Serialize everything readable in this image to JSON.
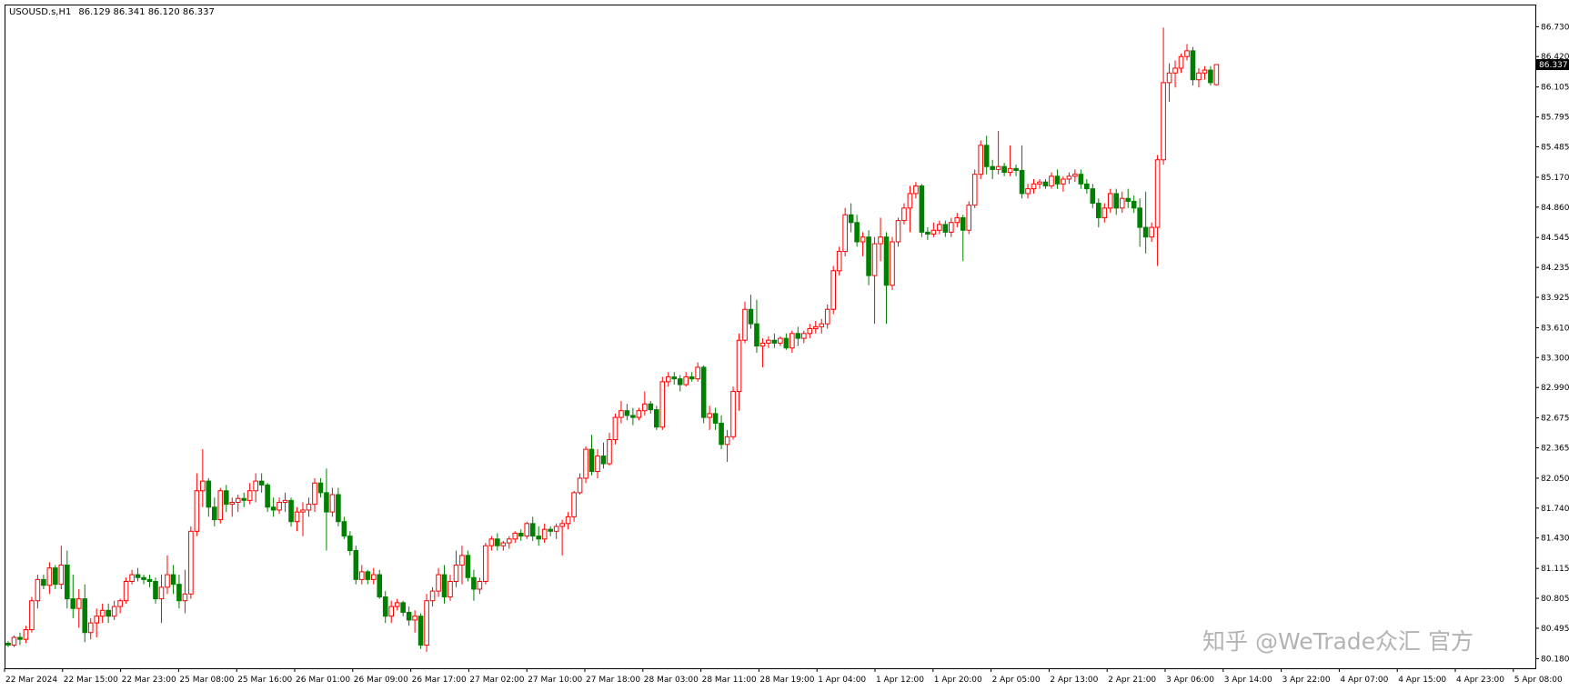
{
  "header": {
    "symbol": "USOUSD.s,H1",
    "ohlc": "86.129 86.341 86.120 86.337"
  },
  "watermark": "知乎 @WeTrade众汇 官方",
  "colors": {
    "bull_body": "#ffffff",
    "bull_outline": "#ff0000",
    "bear_body": "#008000",
    "bear_outline": "#008000",
    "axis": "#000000",
    "price_tag_bg": "#000000",
    "price_tag_text": "#ffffff"
  },
  "chart_data": {
    "type": "candlestick",
    "timeframe": "H1",
    "current_price": "86.337",
    "ylim": [
      80.08,
      86.95
    ],
    "y_ticks": [
      "86.730",
      "86.420",
      "86.105",
      "85.795",
      "85.485",
      "85.170",
      "84.860",
      "84.545",
      "84.235",
      "83.925",
      "83.610",
      "83.300",
      "82.990",
      "82.675",
      "82.365",
      "82.050",
      "81.740",
      "81.430",
      "81.115",
      "80.805",
      "80.495",
      "80.180"
    ],
    "x_ticks": [
      "22 Mar 2024",
      "22 Mar 15:00",
      "22 Mar 23:00",
      "25 Mar 08:00",
      "25 Mar 16:00",
      "26 Mar 01:00",
      "26 Mar 09:00",
      "26 Mar 17:00",
      "27 Mar 02:00",
      "27 Mar 10:00",
      "27 Mar 18:00",
      "28 Mar 03:00",
      "28 Mar 11:00",
      "28 Mar 19:00",
      "1 Apr 04:00",
      "1 Apr 12:00",
      "1 Apr 20:00",
      "2 Apr 05:00",
      "2 Apr 13:00",
      "2 Apr 21:00",
      "3 Apr 06:00",
      "3 Apr 14:00",
      "3 Apr 22:00",
      "4 Apr 07:00",
      "4 Apr 15:00",
      "4 Apr 23:00",
      "5 Apr 08:00"
    ],
    "ohlc": [
      [
        80.34,
        80.36,
        80.3,
        80.32
      ],
      [
        80.32,
        80.42,
        80.3,
        80.4
      ],
      [
        80.4,
        80.45,
        80.32,
        80.38
      ],
      [
        80.38,
        80.52,
        80.34,
        80.48
      ],
      [
        80.48,
        80.82,
        80.45,
        80.78
      ],
      [
        80.78,
        81.05,
        80.7,
        81.0
      ],
      [
        81.0,
        81.05,
        80.9,
        80.94
      ],
      [
        80.94,
        81.18,
        80.85,
        81.12
      ],
      [
        81.12,
        81.15,
        80.9,
        80.95
      ],
      [
        80.95,
        81.35,
        80.9,
        81.15
      ],
      [
        81.15,
        81.3,
        80.7,
        80.8
      ],
      [
        80.8,
        81.05,
        80.6,
        80.7
      ],
      [
        80.7,
        80.9,
        80.5,
        80.8
      ],
      [
        80.8,
        80.95,
        80.35,
        80.45
      ],
      [
        80.45,
        80.6,
        80.38,
        80.55
      ],
      [
        80.55,
        80.7,
        80.4,
        80.62
      ],
      [
        80.62,
        80.75,
        80.55,
        80.68
      ],
      [
        80.68,
        80.75,
        80.55,
        80.62
      ],
      [
        80.62,
        80.78,
        80.58,
        80.72
      ],
      [
        80.72,
        80.8,
        80.65,
        80.78
      ],
      [
        80.78,
        81.02,
        80.75,
        80.98
      ],
      [
        80.98,
        81.1,
        80.95,
        81.05
      ],
      [
        81.05,
        81.12,
        80.98,
        81.02
      ],
      [
        81.02,
        81.05,
        80.95,
        81.0
      ],
      [
        81.0,
        81.05,
        80.92,
        80.98
      ],
      [
        80.98,
        81.02,
        80.75,
        80.8
      ],
      [
        80.8,
        81.05,
        80.55,
        80.92
      ],
      [
        80.92,
        81.25,
        80.85,
        81.05
      ],
      [
        81.05,
        81.15,
        80.85,
        80.95
      ],
      [
        80.95,
        81.05,
        80.7,
        80.78
      ],
      [
        80.78,
        81.1,
        80.65,
        80.85
      ],
      [
        80.85,
        81.55,
        80.8,
        81.5
      ],
      [
        81.5,
        82.1,
        81.45,
        81.92
      ],
      [
        81.92,
        82.35,
        81.75,
        82.02
      ],
      [
        82.02,
        82.05,
        81.65,
        81.75
      ],
      [
        81.75,
        81.85,
        81.55,
        81.62
      ],
      [
        81.62,
        81.95,
        81.58,
        81.92
      ],
      [
        81.92,
        81.98,
        81.7,
        81.78
      ],
      [
        81.78,
        81.85,
        81.65,
        81.8
      ],
      [
        81.8,
        81.88,
        81.7,
        81.84
      ],
      [
        81.84,
        81.9,
        81.75,
        81.82
      ],
      [
        81.82,
        82.0,
        81.78,
        81.92
      ],
      [
        81.92,
        82.1,
        81.8,
        82.02
      ],
      [
        82.02,
        82.1,
        81.9,
        81.98
      ],
      [
        81.98,
        82.0,
        81.7,
        81.75
      ],
      [
        81.75,
        81.85,
        81.65,
        81.72
      ],
      [
        81.72,
        81.85,
        81.68,
        81.8
      ],
      [
        81.8,
        81.9,
        81.7,
        81.82
      ],
      [
        81.82,
        81.85,
        81.55,
        81.6
      ],
      [
        81.6,
        81.75,
        81.5,
        81.7
      ],
      [
        81.7,
        81.8,
        81.45,
        81.72
      ],
      [
        81.72,
        81.85,
        81.65,
        81.78
      ],
      [
        81.78,
        82.05,
        81.7,
        82.0
      ],
      [
        82.0,
        82.05,
        81.85,
        81.9
      ],
      [
        81.9,
        82.15,
        81.3,
        81.7
      ],
      [
        81.7,
        81.95,
        81.65,
        81.88
      ],
      [
        81.88,
        81.95,
        81.55,
        81.6
      ],
      [
        81.6,
        81.65,
        81.42,
        81.45
      ],
      [
        81.45,
        81.5,
        81.25,
        81.3
      ],
      [
        81.3,
        81.35,
        80.95,
        81.0
      ],
      [
        81.0,
        81.15,
        80.95,
        81.08
      ],
      [
        81.08,
        81.1,
        80.95,
        81.0
      ],
      [
        81.0,
        81.12,
        80.95,
        81.05
      ],
      [
        81.05,
        81.1,
        80.8,
        80.82
      ],
      [
        80.82,
        80.88,
        80.55,
        80.62
      ],
      [
        80.62,
        80.78,
        80.55,
        80.72
      ],
      [
        80.72,
        80.8,
        80.68,
        80.76
      ],
      [
        80.76,
        80.78,
        80.62,
        80.66
      ],
      [
        80.66,
        80.72,
        80.52,
        80.58
      ],
      [
        80.58,
        80.68,
        80.45,
        80.62
      ],
      [
        80.62,
        80.65,
        80.28,
        80.32
      ],
      [
        80.32,
        80.85,
        80.25,
        80.78
      ],
      [
        80.78,
        80.92,
        80.72,
        80.88
      ],
      [
        80.88,
        81.12,
        80.82,
        81.05
      ],
      [
        81.05,
        81.15,
        80.75,
        80.82
      ],
      [
        80.82,
        81.05,
        80.78,
        80.98
      ],
      [
        80.98,
        81.3,
        80.92,
        81.15
      ],
      [
        81.15,
        81.35,
        80.95,
        81.25
      ],
      [
        81.25,
        81.3,
        80.98,
        81.02
      ],
      [
        81.02,
        81.1,
        80.78,
        80.9
      ],
      [
        80.9,
        81.02,
        80.85,
        80.98
      ],
      [
        80.98,
        81.38,
        80.95,
        81.35
      ],
      [
        81.35,
        81.45,
        81.3,
        81.42
      ],
      [
        81.42,
        81.48,
        81.3,
        81.35
      ],
      [
        81.35,
        81.4,
        81.3,
        81.38
      ],
      [
        81.38,
        81.45,
        81.32,
        81.42
      ],
      [
        81.42,
        81.5,
        81.38,
        81.48
      ],
      [
        81.48,
        81.52,
        81.4,
        81.45
      ],
      [
        81.45,
        81.6,
        81.42,
        81.58
      ],
      [
        81.58,
        81.65,
        81.4,
        81.45
      ],
      [
        81.45,
        81.55,
        81.35,
        81.42
      ],
      [
        81.42,
        81.58,
        81.38,
        81.52
      ],
      [
        81.52,
        81.55,
        81.45,
        81.5
      ],
      [
        81.5,
        81.58,
        81.42,
        81.55
      ],
      [
        81.55,
        81.62,
        81.25,
        81.58
      ],
      [
        81.58,
        81.7,
        81.52,
        81.65
      ],
      [
        81.65,
        81.92,
        81.6,
        81.9
      ],
      [
        81.9,
        82.1,
        81.88,
        82.05
      ],
      [
        82.05,
        82.38,
        82.0,
        82.35
      ],
      [
        82.35,
        82.5,
        82.08,
        82.12
      ],
      [
        82.12,
        82.35,
        82.05,
        82.28
      ],
      [
        82.28,
        82.42,
        82.15,
        82.2
      ],
      [
        82.2,
        82.52,
        82.18,
        82.45
      ],
      [
        82.45,
        82.72,
        82.4,
        82.68
      ],
      [
        82.68,
        82.85,
        82.62,
        82.75
      ],
      [
        82.75,
        82.82,
        82.65,
        82.7
      ],
      [
        82.7,
        82.78,
        82.6,
        82.68
      ],
      [
        82.68,
        82.78,
        82.65,
        82.75
      ],
      [
        82.75,
        82.95,
        82.7,
        82.82
      ],
      [
        82.82,
        82.85,
        82.72,
        82.76
      ],
      [
        82.76,
        82.8,
        82.55,
        82.58
      ],
      [
        82.58,
        83.1,
        82.55,
        83.05
      ],
      [
        83.05,
        83.15,
        83.0,
        83.1
      ],
      [
        83.1,
        83.15,
        83.02,
        83.08
      ],
      [
        83.08,
        83.12,
        82.95,
        83.02
      ],
      [
        83.02,
        83.15,
        83.0,
        83.1
      ],
      [
        83.1,
        83.15,
        83.05,
        83.08
      ],
      [
        83.08,
        83.25,
        83.05,
        83.2
      ],
      [
        83.2,
        83.22,
        82.62,
        82.68
      ],
      [
        82.68,
        82.8,
        82.55,
        82.72
      ],
      [
        82.72,
        82.78,
        82.55,
        82.62
      ],
      [
        82.62,
        82.7,
        82.35,
        82.4
      ],
      [
        82.4,
        82.55,
        82.22,
        82.48
      ],
      [
        82.48,
        83.0,
        82.45,
        82.95
      ],
      [
        82.95,
        83.55,
        82.75,
        83.48
      ],
      [
        83.48,
        83.88,
        83.45,
        83.8
      ],
      [
        83.8,
        83.95,
        83.6,
        83.65
      ],
      [
        83.65,
        83.9,
        83.35,
        83.42
      ],
      [
        83.42,
        83.5,
        83.2,
        83.45
      ],
      [
        83.45,
        83.52,
        83.4,
        83.48
      ],
      [
        83.48,
        83.55,
        83.4,
        83.45
      ],
      [
        83.45,
        83.52,
        83.42,
        83.5
      ],
      [
        83.5,
        83.55,
        83.38,
        83.4
      ],
      [
        83.4,
        83.58,
        83.35,
        83.55
      ],
      [
        83.55,
        83.62,
        83.42,
        83.5
      ],
      [
        83.5,
        83.58,
        83.45,
        83.55
      ],
      [
        83.55,
        83.65,
        83.5,
        83.6
      ],
      [
        83.6,
        83.68,
        83.55,
        83.62
      ],
      [
        83.62,
        83.7,
        83.55,
        83.65
      ],
      [
        83.65,
        83.85,
        83.6,
        83.8
      ],
      [
        83.8,
        84.25,
        83.75,
        84.2
      ],
      [
        84.2,
        84.45,
        84.15,
        84.4
      ],
      [
        84.4,
        84.85,
        84.35,
        84.78
      ],
      [
        84.78,
        84.9,
        84.6,
        84.7
      ],
      [
        84.7,
        84.78,
        84.45,
        84.5
      ],
      [
        84.5,
        84.6,
        84.35,
        84.55
      ],
      [
        84.55,
        84.62,
        84.05,
        84.15
      ],
      [
        84.15,
        84.55,
        83.65,
        84.48
      ],
      [
        84.48,
        84.75,
        84.3,
        84.55
      ],
      [
        84.55,
        84.6,
        83.65,
        84.05
      ],
      [
        84.05,
        84.55,
        84.0,
        84.5
      ],
      [
        84.5,
        84.75,
        84.45,
        84.72
      ],
      [
        84.72,
        84.9,
        84.68,
        84.85
      ],
      [
        84.85,
        85.08,
        84.6,
        85.0
      ],
      [
        85.0,
        85.12,
        84.95,
        85.08
      ],
      [
        85.08,
        85.1,
        84.55,
        84.6
      ],
      [
        84.6,
        84.65,
        84.52,
        84.58
      ],
      [
        84.58,
        84.7,
        84.55,
        84.62
      ],
      [
        84.62,
        84.72,
        84.58,
        84.68
      ],
      [
        84.68,
        84.72,
        84.55,
        84.6
      ],
      [
        84.6,
        84.75,
        84.55,
        84.7
      ],
      [
        84.7,
        84.8,
        84.65,
        84.75
      ],
      [
        84.75,
        84.78,
        84.3,
        84.62
      ],
      [
        84.62,
        84.92,
        84.58,
        84.88
      ],
      [
        84.88,
        85.25,
        84.85,
        85.2
      ],
      [
        85.2,
        85.55,
        85.15,
        85.5
      ],
      [
        85.5,
        85.6,
        85.2,
        85.28
      ],
      [
        85.28,
        85.35,
        85.15,
        85.25
      ],
      [
        85.25,
        85.65,
        85.2,
        85.28
      ],
      [
        85.28,
        85.32,
        85.18,
        85.22
      ],
      [
        85.22,
        85.5,
        85.18,
        85.26
      ],
      [
        85.26,
        85.3,
        85.18,
        85.24
      ],
      [
        85.24,
        85.5,
        84.95,
        85.0
      ],
      [
        85.0,
        85.1,
        84.95,
        85.05
      ],
      [
        85.05,
        85.15,
        85.0,
        85.1
      ],
      [
        85.1,
        85.15,
        85.05,
        85.12
      ],
      [
        85.12,
        85.15,
        85.05,
        85.08
      ],
      [
        85.08,
        85.22,
        85.05,
        85.18
      ],
      [
        85.18,
        85.25,
        85.05,
        85.1
      ],
      [
        85.1,
        85.18,
        85.02,
        85.15
      ],
      [
        85.15,
        85.22,
        85.1,
        85.18
      ],
      [
        85.18,
        85.25,
        85.12,
        85.2
      ],
      [
        85.2,
        85.25,
        85.05,
        85.1
      ],
      [
        85.1,
        85.15,
        85.0,
        85.05
      ],
      [
        85.05,
        85.1,
        84.85,
        84.9
      ],
      [
        84.9,
        84.95,
        84.65,
        84.75
      ],
      [
        84.75,
        84.9,
        84.7,
        84.85
      ],
      [
        84.85,
        85.05,
        84.8,
        85.0
      ],
      [
        85.0,
        85.05,
        84.78,
        84.85
      ],
      [
        84.85,
        85.02,
        84.8,
        84.95
      ],
      [
        84.95,
        85.05,
        84.85,
        84.92
      ],
      [
        84.92,
        84.98,
        84.8,
        84.85
      ],
      [
        84.85,
        84.95,
        84.45,
        84.65
      ],
      [
        84.65,
        85.02,
        84.38,
        84.55
      ],
      [
        84.55,
        84.7,
        84.5,
        84.65
      ],
      [
        84.65,
        85.4,
        84.25,
        85.35
      ],
      [
        85.35,
        86.72,
        85.3,
        86.15
      ],
      [
        86.15,
        86.35,
        85.95,
        86.25
      ],
      [
        86.25,
        86.38,
        86.1,
        86.3
      ],
      [
        86.3,
        86.45,
        86.25,
        86.42
      ],
      [
        86.42,
        86.55,
        86.38,
        86.48
      ],
      [
        86.48,
        86.52,
        86.12,
        86.18
      ],
      [
        86.18,
        86.3,
        86.1,
        86.25
      ],
      [
        86.25,
        86.32,
        86.18,
        86.28
      ],
      [
        86.28,
        86.32,
        86.12,
        86.15
      ],
      [
        86.129,
        86.341,
        86.12,
        86.337
      ]
    ]
  }
}
